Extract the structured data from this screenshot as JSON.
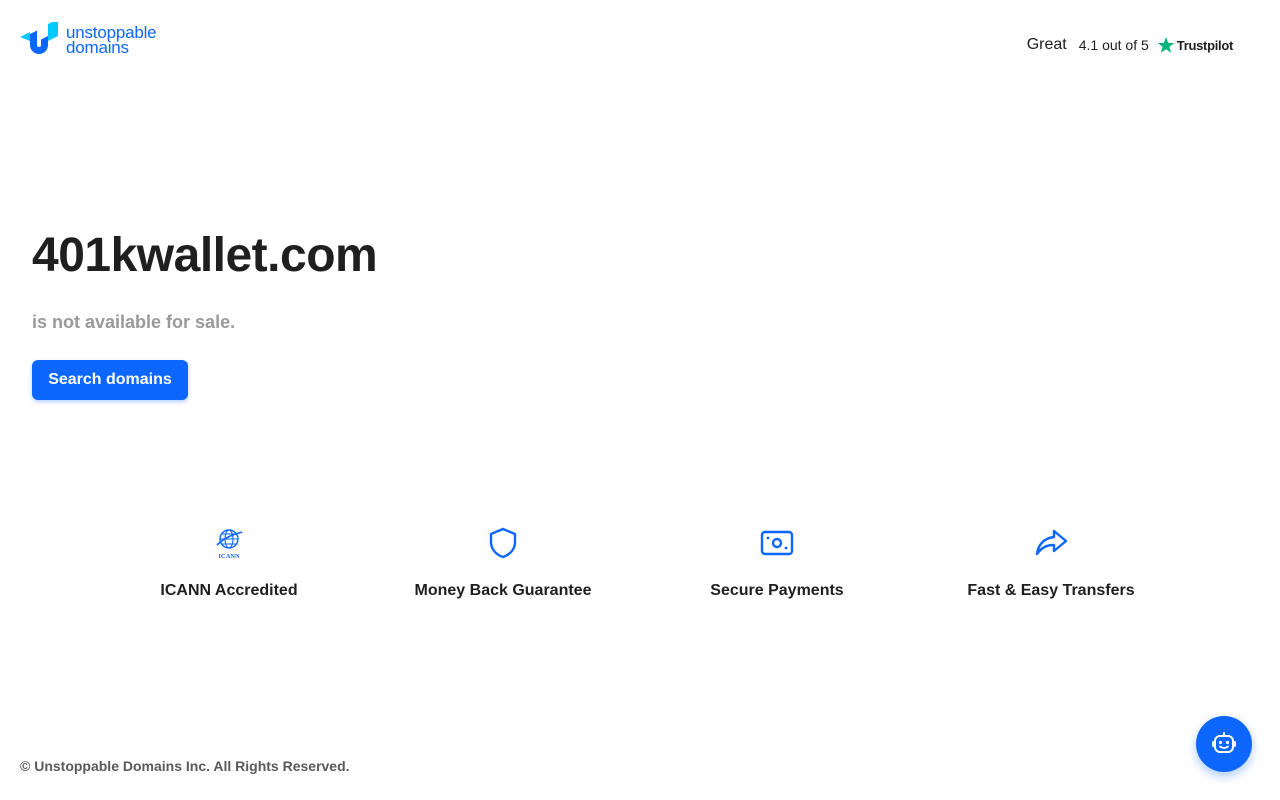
{
  "header": {
    "logo": {
      "line1": "unstoppable",
      "line2": "domains"
    },
    "trustpilot": {
      "rating_word": "Great",
      "score": "4.1 out of 5",
      "brand": "Trustpilot"
    }
  },
  "hero": {
    "domain": "401kwallet.com",
    "status": "is not available for sale.",
    "search_button": "Search domains"
  },
  "features": [
    {
      "label": "ICANN Accredited",
      "icon": "icann-globe-icon"
    },
    {
      "label": "Money Back Guarantee",
      "icon": "shield-icon"
    },
    {
      "label": "Secure Payments",
      "icon": "payment-card-icon"
    },
    {
      "label": "Fast & Easy Transfers",
      "icon": "forward-arrow-icon"
    }
  ],
  "icann_caption": "ICANN",
  "footer": {
    "copyright": "© Unstoppable Domains Inc. All Rights Reserved."
  },
  "chat": {
    "icon": "chatbot-icon"
  },
  "colors": {
    "brand_blue": "#0d67fe",
    "trustpilot_green": "#00b67a",
    "text_dark": "#1f1f1f",
    "text_muted": "#9a9a9a"
  }
}
